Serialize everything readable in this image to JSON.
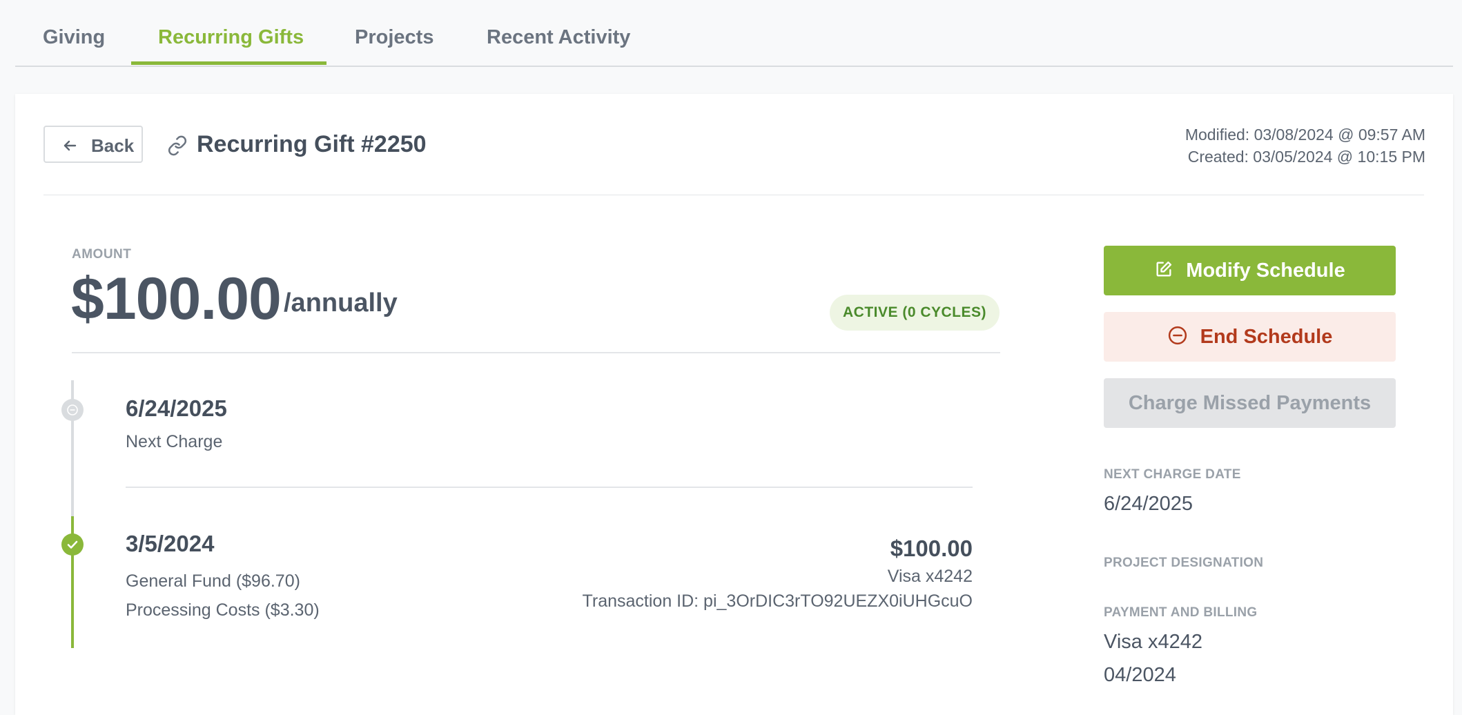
{
  "tabs": [
    {
      "label": "Giving",
      "active": false
    },
    {
      "label": "Recurring Gifts",
      "active": true
    },
    {
      "label": "Projects",
      "active": false
    },
    {
      "label": "Recent Activity",
      "active": false
    }
  ],
  "header": {
    "back_label": "Back",
    "title": "Recurring Gift #2250",
    "modified": "Modified: 03/08/2024 @ 09:57 AM",
    "created": "Created: 03/05/2024 @ 10:15 PM"
  },
  "amount": {
    "label": "AMOUNT",
    "value": "$100.00",
    "period": "/annually",
    "status": "ACTIVE (0 CYCLES)"
  },
  "timeline": {
    "upcoming": {
      "date": "6/24/2025",
      "label": "Next Charge"
    },
    "completed": {
      "date": "3/5/2024",
      "lines": [
        "General Fund ($96.70)",
        "Processing Costs ($3.30)"
      ],
      "amount": "$100.00",
      "card": "Visa x4242",
      "transaction": "Transaction ID: pi_3OrDIC3rTO92UEZX0iUHGcuO"
    }
  },
  "actions": {
    "modify": "Modify Schedule",
    "end": "End Schedule",
    "charge_missed": "Charge Missed Payments"
  },
  "details": {
    "next_charge_label": "NEXT CHARGE DATE",
    "next_charge_value": "6/24/2025",
    "project_label": "PROJECT DESIGNATION",
    "payment_label": "PAYMENT AND BILLING",
    "payment_card": "Visa x4242",
    "payment_exp": "04/2024"
  },
  "colors": {
    "accent": "#8ab83a",
    "danger": "#b23a1c",
    "danger_bg": "#fbece8",
    "status_bg": "#eef5e3",
    "status_text": "#4a8a2b"
  }
}
